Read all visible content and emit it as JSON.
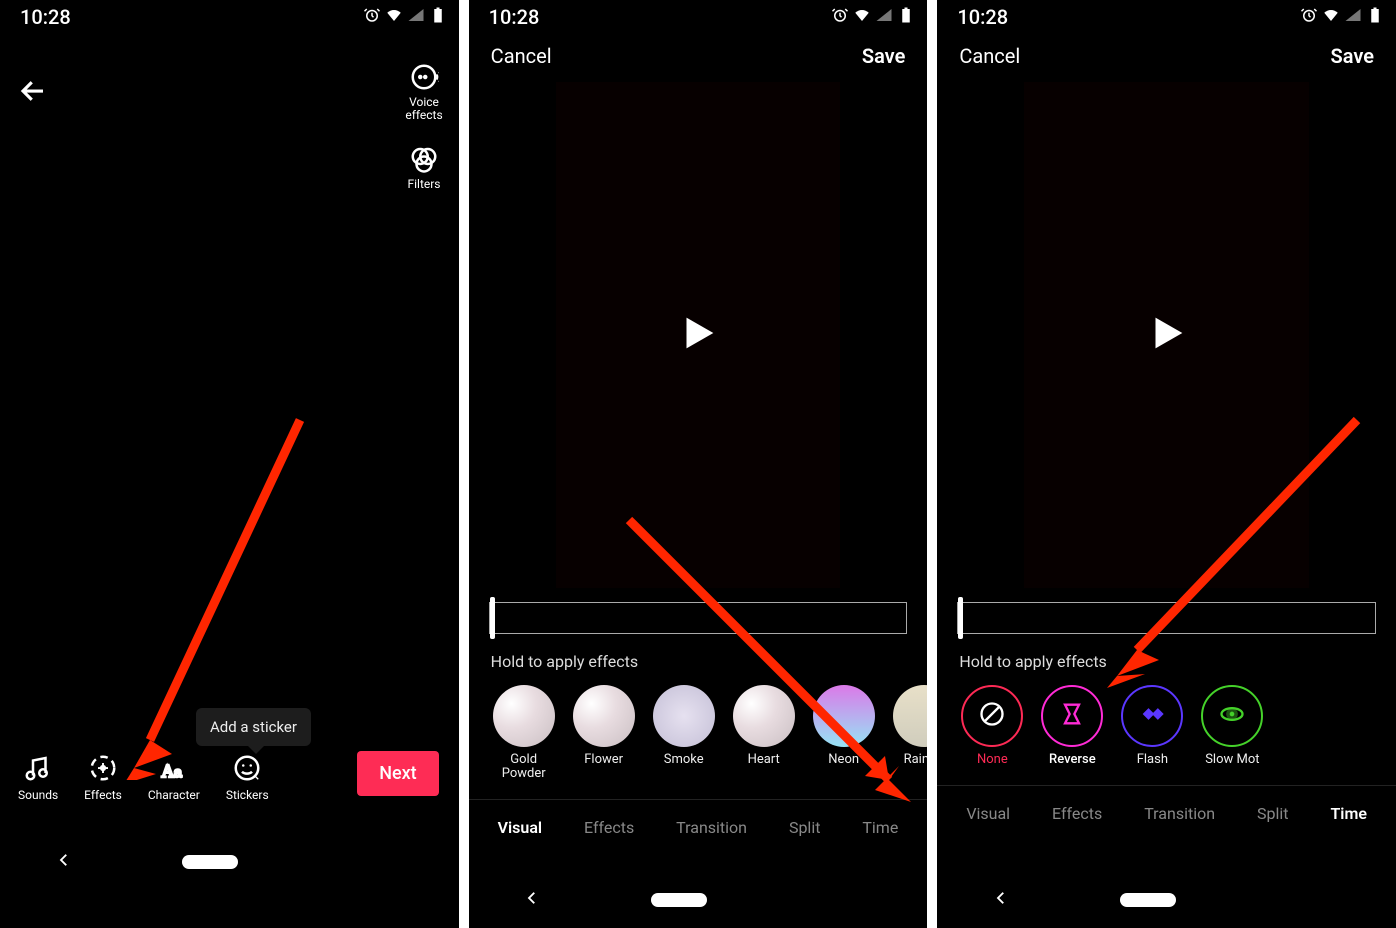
{
  "status": {
    "time": "10:28"
  },
  "screen1": {
    "side": {
      "voice": "Voice\neffects",
      "filters": "Filters"
    },
    "tip": "Add a sticker",
    "bottom": {
      "sounds": "Sounds",
      "effects": "Effects",
      "character": "Character",
      "stickers": "Stickers"
    },
    "next": "Next"
  },
  "screen2": {
    "top": {
      "cancel": "Cancel",
      "save": "Save"
    },
    "hint": "Hold to apply effects",
    "effects": {
      "gold": "Gold\nPowder",
      "flower": "Flower",
      "smoke": "Smoke",
      "heart": "Heart",
      "neon": "Neon",
      "rainbow": "Rainbo"
    },
    "tabs": {
      "visual": "Visual",
      "effects": "Effects",
      "transition": "Transition",
      "split": "Split",
      "time": "Time"
    }
  },
  "screen3": {
    "top": {
      "cancel": "Cancel",
      "save": "Save"
    },
    "hint": "Hold to apply effects",
    "effects": {
      "none": "None",
      "reverse": "Reverse",
      "flash": "Flash",
      "slow": "Slow Mot"
    },
    "tabs": {
      "visual": "Visual",
      "effects": "Effects",
      "transition": "Transition",
      "split": "Split",
      "time": "Time"
    }
  }
}
